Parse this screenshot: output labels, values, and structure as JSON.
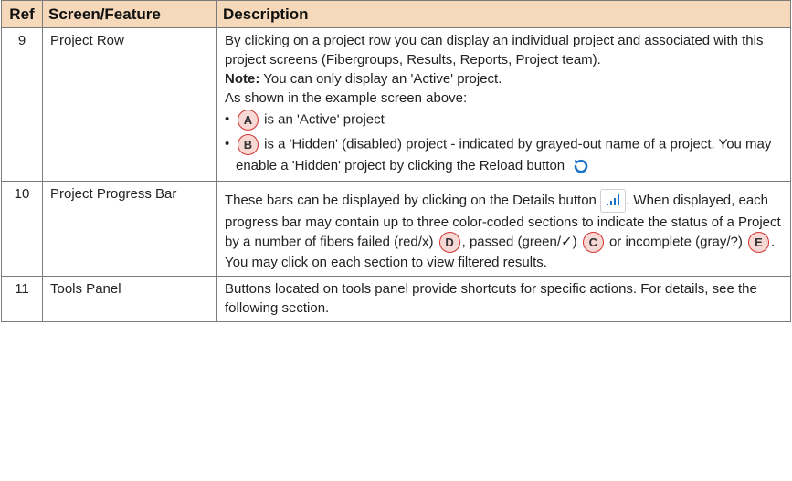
{
  "table": {
    "headers": {
      "ref": "Ref",
      "feature": "Screen/Feature",
      "description": "Description"
    },
    "rows": [
      {
        "ref": "9",
        "feature": "Project Row",
        "intro": "By clicking on a project row you can display an individual project and associated with this project screens (Fibergroups, Results, Reports, Project team).",
        "note_label": "Note:",
        "note_text": " You can only display an 'Active' project.",
        "example_text": "As shown in the example screen above:",
        "bullet_a_callout": "A",
        "bullet_a_text": "is an 'Active' project",
        "bullet_b_callout": "B",
        "bullet_b_text": "is a 'Hidden' (disabled) project - indicated by grayed-out name of a project. You may enable a 'Hidden' project by clicking the Reload button",
        "reload_icon": "reload-icon"
      },
      {
        "ref": "10",
        "feature": "Project Progress Bar",
        "part1": "These bars can be displayed by clicking on the Details button",
        "details_icon": "bar-chart-icon",
        "part2": ". When displayed, each progress bar may contain up to three color-coded sections to indicate the status of a Project by a number of fibers failed (red/x)",
        "callout_d": "D",
        "part3": ", passed (green/",
        "check": "✓",
        "part4": ")",
        "callout_c": "C",
        "part5": "or incomplete (gray/?)",
        "callout_e": "E",
        "part6": ". You may click on each section to view filtered results."
      },
      {
        "ref": "11",
        "feature": "Tools Panel",
        "description": "Buttons located on tools panel provide shortcuts for specific actions. For details, see the following section."
      }
    ]
  },
  "colors": {
    "header_bg": "#f6d9ba",
    "callout_border": "#d1342f",
    "callout_fill": "#f8d8d4",
    "icon_blue": "#1a73c9"
  }
}
